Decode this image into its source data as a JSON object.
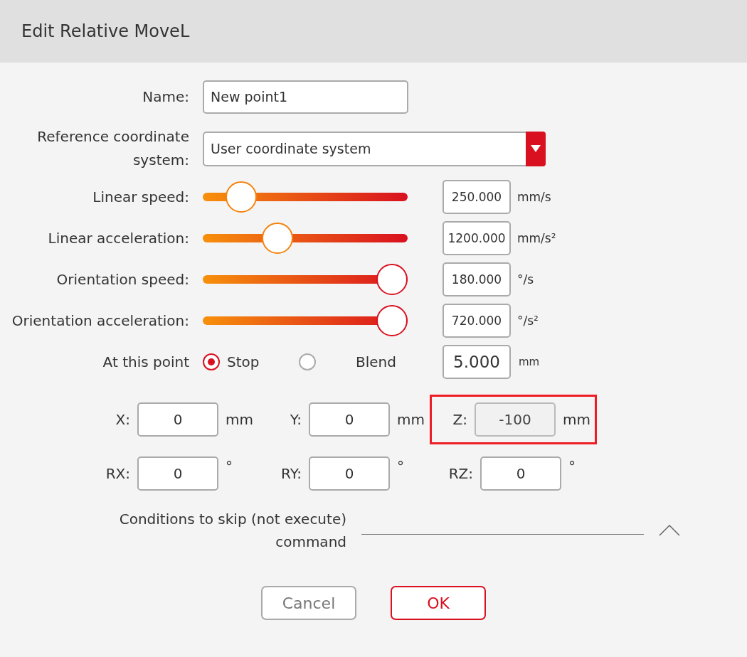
{
  "window": {
    "title": "Edit Relative MoveL"
  },
  "name": {
    "label": "Name:",
    "value": "New point1"
  },
  "reference": {
    "label": "Reference coordinate system:",
    "value": "User coordinate system"
  },
  "sliders": [
    {
      "label": "Linear speed:",
      "level": 0.13,
      "value": "250.000",
      "unit": "mm/s"
    },
    {
      "label": "Linear acceleration:",
      "level": 0.34,
      "value": "1200.000",
      "unit": "mm/s²"
    },
    {
      "label": "Orientation speed:",
      "level": 1,
      "value": "180.000",
      "unit": "°/s"
    },
    {
      "label": "Orientation acceleration:",
      "level": 1,
      "value": "720.000",
      "unit": "°/s²"
    }
  ],
  "at_point": {
    "label": "At this point",
    "options": [
      {
        "label": "Stop",
        "selected": true
      },
      {
        "label": "Blend",
        "selected": false
      }
    ],
    "value": "5.000",
    "unit": "mm"
  },
  "coordinates": [
    [
      {
        "label": "X:",
        "value": "0",
        "unit": "mm",
        "disabled": false,
        "highlighted": false
      },
      {
        "label": "Y:",
        "value": "0",
        "unit": "mm",
        "disabled": false,
        "highlighted": false
      },
      {
        "label": "Z:",
        "value": "-100",
        "unit": "mm",
        "disabled": true,
        "highlighted": true
      }
    ],
    [
      {
        "label": "RX:",
        "value": "0",
        "unit": "°",
        "disabled": false,
        "highlighted": false
      },
      {
        "label": "RY:",
        "value": "0",
        "unit": "°",
        "disabled": false,
        "highlighted": false
      },
      {
        "label": "RZ:",
        "value": "0",
        "unit": "°",
        "disabled": false,
        "highlighted": false
      }
    ]
  ],
  "skip_conditions": {
    "label": "Conditions to skip (not execute) command"
  },
  "buttons": [
    {
      "label": "Cancel",
      "kind": "secondary"
    },
    {
      "label": "OK",
      "kind": "primary"
    }
  ]
}
